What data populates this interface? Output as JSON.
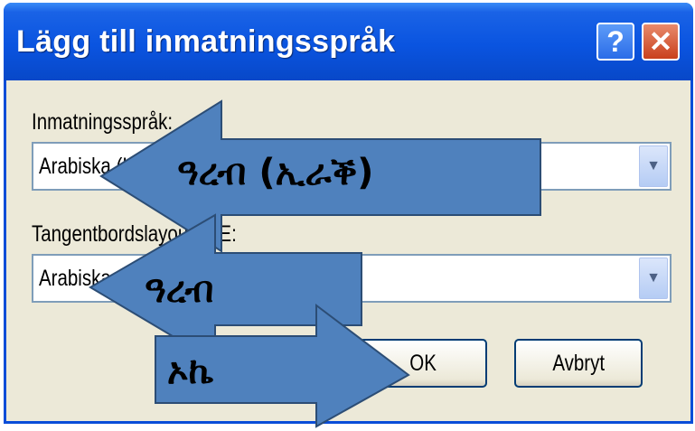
{
  "window": {
    "title": "Lägg till inmatningsspråk",
    "help_icon": "question-mark-icon",
    "close_icon": "close-x-icon"
  },
  "form": {
    "input_language_label": "Inmatningsspråk:",
    "input_language_value": "Arabiska (Irak)",
    "keyboard_layout_label": "Tangentbordslayout/IME:",
    "keyboard_layout_value": "Arabiska"
  },
  "buttons": {
    "ok_label": "OK",
    "cancel_label": "Avbryt"
  },
  "annotations": {
    "arrow1_text": "ዓረብ (ኢራቕ)",
    "arrow2_text": "ዓረብ",
    "arrow3_text": "ኦኬ",
    "arrow_color": "#4f81bd"
  }
}
